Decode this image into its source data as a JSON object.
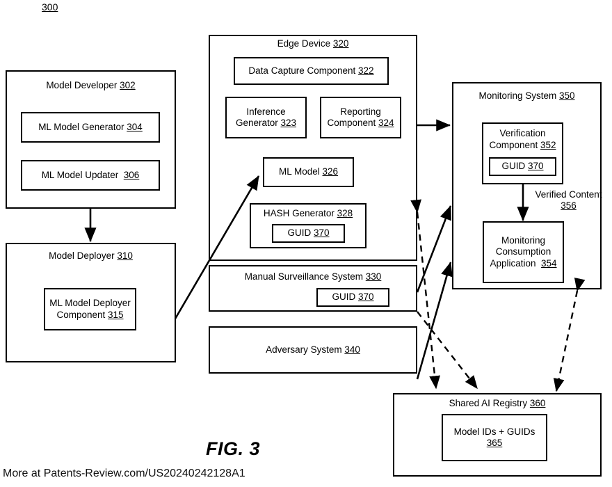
{
  "figure": {
    "number": "300",
    "caption": "FIG. 3",
    "footer": "More at Patents-Review.com/US20240242128A1"
  },
  "blocks": {
    "model_developer": {
      "title": "Model Developer",
      "ref": "302",
      "children": [
        {
          "label": "ML Model Generator",
          "ref": "304"
        },
        {
          "label": "ML Model Updater",
          "ref": "306"
        }
      ]
    },
    "model_deployer": {
      "title": "Model Deployer",
      "ref": "310",
      "children": [
        {
          "label": "ML Model Deployer Component",
          "ref": "315"
        }
      ]
    },
    "edge_device": {
      "title": "Edge Device",
      "ref": "320",
      "children": [
        {
          "label": "Data Capture Component",
          "ref": "322"
        },
        {
          "label": "Inference Generator",
          "ref": "323"
        },
        {
          "label": "Reporting Component",
          "ref": "324"
        },
        {
          "label": "ML Model",
          "ref": "326"
        },
        {
          "label": "HASH Generator",
          "ref": "328"
        },
        {
          "label": "GUID",
          "ref": "370"
        }
      ]
    },
    "manual_surveillance": {
      "title": "Manual Surveillance System",
      "ref": "330",
      "children": [
        {
          "label": "GUID",
          "ref": "370"
        }
      ]
    },
    "adversary_system": {
      "title": "Adversary System",
      "ref": "340",
      "children": []
    },
    "monitoring_system": {
      "title": "Monitoring System",
      "ref": "350",
      "children": [
        {
          "label": "Verification Component",
          "ref": "352"
        },
        {
          "label": "GUID",
          "ref": "370"
        },
        {
          "label": "Monitoring Consumption Application",
          "ref": "354"
        }
      ]
    },
    "shared_ai_registry": {
      "title": "Shared AI Registry",
      "ref": "360",
      "children": [
        {
          "label": "Model IDs + GUIDs",
          "ref": "365"
        }
      ]
    }
  },
  "edge_labels": {
    "verified_content": "Verified Content",
    "verified_content_ref": "356"
  },
  "colors": {
    "stroke": "#000000",
    "background": "#ffffff"
  }
}
